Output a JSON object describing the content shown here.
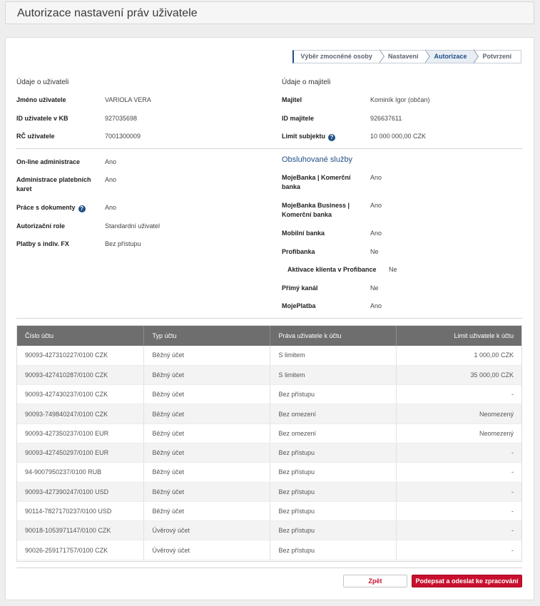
{
  "page": {
    "title": "Autorizace nastavení práv uživatele"
  },
  "steps": [
    {
      "label": "Výběr zmocněné osoby",
      "active": false
    },
    {
      "label": "Nastavení",
      "active": false
    },
    {
      "label": "Autorizace",
      "active": true
    },
    {
      "label": "Potvrzení",
      "active": false
    }
  ],
  "user": {
    "section_title": "Údaje o uživateli",
    "name_label": "Jméno uživatele",
    "name": "VARIOLA VERA",
    "id_label": "ID uživatele v KB",
    "id": "927035698",
    "rc_label": "RČ uživatele",
    "rc": "7001300009"
  },
  "owner": {
    "section_title": "Údaje o majiteli",
    "owner_label": "Majitel",
    "owner": "Kominík Igor (občan)",
    "id_label": "ID majitele",
    "id": "926637611",
    "limit_label": "Limit subjektu",
    "limit": "10 000 000,00 CZK"
  },
  "rights": {
    "online_label": "On-line administrace",
    "online": "Ano",
    "cards_label": "Administrace platebních karet",
    "cards": "Ano",
    "docs_label": "Práce s dokumenty",
    "docs": "Ano",
    "role_label": "Autorizační role",
    "role": "Standardní uživatel",
    "fx_label": "Platby s indiv. FX",
    "fx": "Bez přístupu"
  },
  "services": {
    "title": "Obsluhované služby",
    "mojebanka_label": "MojeBanka | Komerční banka",
    "mojebanka": "Ano",
    "business_label": "MojeBanka Business | Komerční banka",
    "business": "Ano",
    "mobile_label": "Mobilní banka",
    "mobile": "Ano",
    "profibanka_label": "Profibanka",
    "profibanka": "Ne",
    "activation_label": "Aktivace klienta v Profibance",
    "activation": "Ne",
    "direct_label": "Přímý kanál",
    "direct": "Ne",
    "platba_label": "MojePlatba",
    "platba": "Ano"
  },
  "table": {
    "headers": [
      "Číslo účtu",
      "Typ účtu",
      "Práva uživatele k účtu",
      "Limit uživatele k účtu"
    ],
    "rows": [
      [
        "90093-427310227/0100 CZK",
        "Běžný účet",
        "S limitem",
        "1 000,00 CZK"
      ],
      [
        "90093-427410287/0100 CZK",
        "Běžný účet",
        "S limitem",
        "35 000,00 CZK"
      ],
      [
        "90093-427430237/0100 CZK",
        "Běžný účet",
        "Bez přístupu",
        "-"
      ],
      [
        "90093-749840247/0100 CZK",
        "Běžný účet",
        "Bez omezení",
        "Neomezený"
      ],
      [
        "90093-427350237/0100 EUR",
        "Běžný účet",
        "Bez omezení",
        "Neomezený"
      ],
      [
        "90093-427450297/0100 EUR",
        "Běžný účet",
        "Bez přístupu",
        "-"
      ],
      [
        "94-9007950237/0100 RUB",
        "Běžný účet",
        "Bez přístupu",
        "-"
      ],
      [
        "90093-427390247/0100 USD",
        "Běžný účet",
        "Bez přístupu",
        "-"
      ],
      [
        "90114-7827170237/0100 USD",
        "Běžný účet",
        "Bez přístupu",
        "-"
      ],
      [
        "90018-1053971147/0100 CZK",
        "Úvěrový účet",
        "Bez přístupu",
        "-"
      ],
      [
        "90026-259171757/0100 CZK",
        "Úvěrový účet",
        "Bez přístupu",
        "-"
      ]
    ]
  },
  "buttons": {
    "back": "Zpět",
    "sign": "Podepsat a odeslat ke zpracování"
  }
}
